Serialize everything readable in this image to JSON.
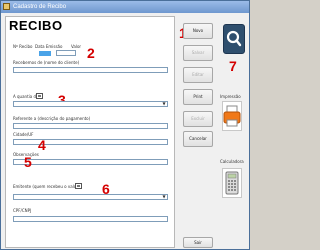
{
  "window": {
    "title": "Cadastro de Recibo"
  },
  "form": {
    "heading": "RECIBO",
    "labels": {
      "number": "Nº Recibo",
      "date": "Data Emissão",
      "value": "Valor",
      "payer": "Recebemos de (nome do cliente)",
      "amount_words": "A quantia de",
      "reference": "Referente a (descrição do pagamento)",
      "city": "Cidade/UF",
      "observations": "Observações",
      "issuer": "Emitente (quem recebeu o valor)",
      "cpf": "CPF/CNPJ"
    }
  },
  "buttons": {
    "new": "Novo",
    "save": "Salvar",
    "edit": "Editar",
    "print": "Print",
    "delete": "Excluir",
    "cancel": "Cancelar",
    "exit": "Sair"
  },
  "tools": {
    "search_icon": "search-icon",
    "printer_label": "Impressão",
    "printer_icon": "printer-icon",
    "calculator_label": "Calculadora",
    "calculator_icon": "calculator-icon"
  },
  "annotations": [
    "1",
    "2",
    "3",
    "4",
    "5",
    "6",
    "7"
  ],
  "colors": {
    "annotation": "#d40000",
    "accent": "#4aa3e8",
    "search_tile": "#2f4f6e"
  }
}
